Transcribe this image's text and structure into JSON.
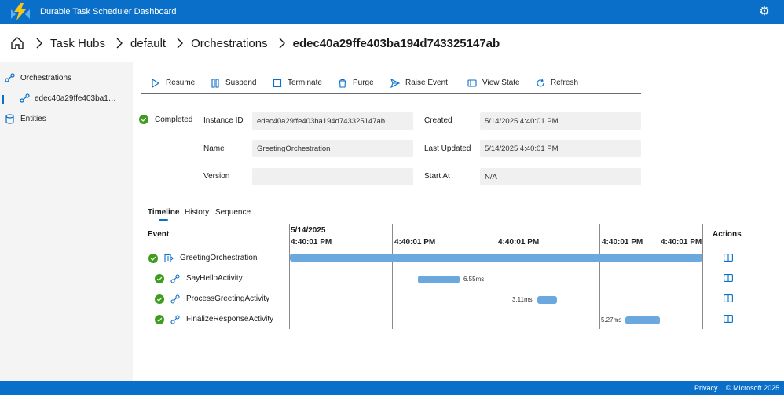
{
  "app": {
    "title": "Durable Task Scheduler Dashboard",
    "logo_icon": "azure-functions-bolt-icon",
    "settings_icon": "gear-icon"
  },
  "breadcrumb": {
    "items": [
      "Task Hubs",
      "default",
      "Orchestrations"
    ],
    "current": "edec40a29ffe403ba194d743325147ab"
  },
  "sidebar": {
    "items": [
      {
        "label": "Orchestrations",
        "icon": "orchestration-icon"
      },
      {
        "label": "edec40a29ffe403ba1…",
        "icon": "orchestration-icon"
      },
      {
        "label": "Entities",
        "icon": "database-icon"
      }
    ]
  },
  "toolbar": {
    "resume": "Resume",
    "suspend": "Suspend",
    "terminate": "Terminate",
    "purge": "Purge",
    "raise_event": "Raise Event",
    "view_state": "View State",
    "refresh": "Refresh"
  },
  "details": {
    "status": "Completed",
    "instance_id_label": "Instance ID",
    "instance_id": "edec40a29ffe403ba194d743325147ab",
    "name_label": "Name",
    "name": "GreetingOrchestration",
    "version_label": "Version",
    "version": "",
    "created_label": "Created",
    "created": "5/14/2025 4:40:01 PM",
    "last_updated_label": "Last Updated",
    "last_updated": "5/14/2025 4:40:01 PM",
    "start_at_label": "Start At",
    "start_at": "N/A"
  },
  "tabs": [
    "Timeline",
    "History",
    "Sequence"
  ],
  "timeline": {
    "event_header": "Event",
    "actions_header": "Actions",
    "date": "5/14/2025",
    "ticks": [
      "4:40:01 PM",
      "4:40:01 PM",
      "4:40:01 PM",
      "4:40:01 PM",
      "4:40:01 PM"
    ],
    "rows": [
      {
        "name": "GreetingOrchestration",
        "duration": ""
      },
      {
        "name": "SayHelloActivity",
        "duration": "6.55ms"
      },
      {
        "name": "ProcessGreetingActivity",
        "duration": "3.11ms"
      },
      {
        "name": "FinalizeResponseActivity",
        "duration": "5.27ms"
      }
    ]
  },
  "footer": {
    "privacy": "Privacy",
    "copyright": "© Microsoft 2025"
  },
  "colors": {
    "brand": "#0a6fc9",
    "success": "#3e9d1d",
    "bar": "#6aa8de"
  }
}
